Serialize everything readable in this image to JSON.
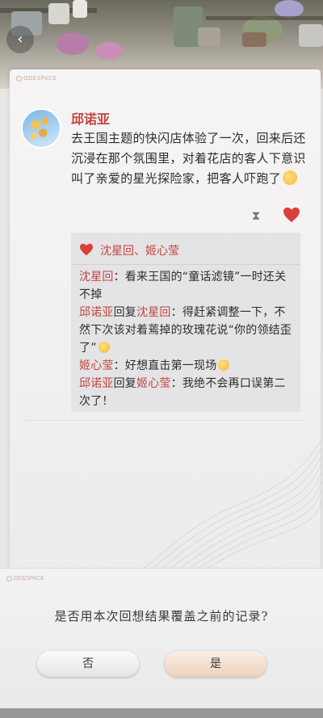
{
  "header": {
    "back_icon": "chevron-left-icon",
    "back_glyph": "‹"
  },
  "card": {
    "brand": "ODESPACE",
    "post": {
      "author": "邱诺亚",
      "text": "去王国主题的快闪店体验了一次，回来后还沉浸在那个氛围里，对着花店的客人下意识叫了亲爱的星光探险家，把客人吓跑了",
      "text_emoji": "shy-face-emoji",
      "actions": {
        "hourglass_icon": "hourglass-icon",
        "like_icon": "heart-icon"
      },
      "likes": "沈星回、姬心莹",
      "comments": [
        {
          "name": "沈星回",
          "reply_word": "",
          "reply_to": "",
          "text": "：看来王国的“童话滤镜”一时还关不掉",
          "emoji": ""
        },
        {
          "name": "邱诺亚",
          "reply_word": "回复",
          "reply_to": "沈星回",
          "text": "：得赶紧调整一下，不然下次该对着蔫掉的玫瑰花说“你的领结歪了”",
          "emoji": "smile-emoji"
        },
        {
          "name": "姬心莹",
          "reply_word": "",
          "reply_to": "",
          "text": "：好想直击第一现场",
          "emoji": "laugh-emoji"
        },
        {
          "name": "邱诺亚",
          "reply_word": "回复",
          "reply_to": "姬心莹",
          "text": "：我绝不会再口误第二次了！",
          "emoji": ""
        }
      ]
    }
  },
  "dialog": {
    "brand": "ODESPACE",
    "question": "是否用本次回想结果覆盖之前的记录?",
    "no_label": "否",
    "yes_label": "是"
  },
  "colors": {
    "accent_red": "#c0463c",
    "comment_bg": "#e4e3e6",
    "yes_button": "#efd2bd"
  }
}
